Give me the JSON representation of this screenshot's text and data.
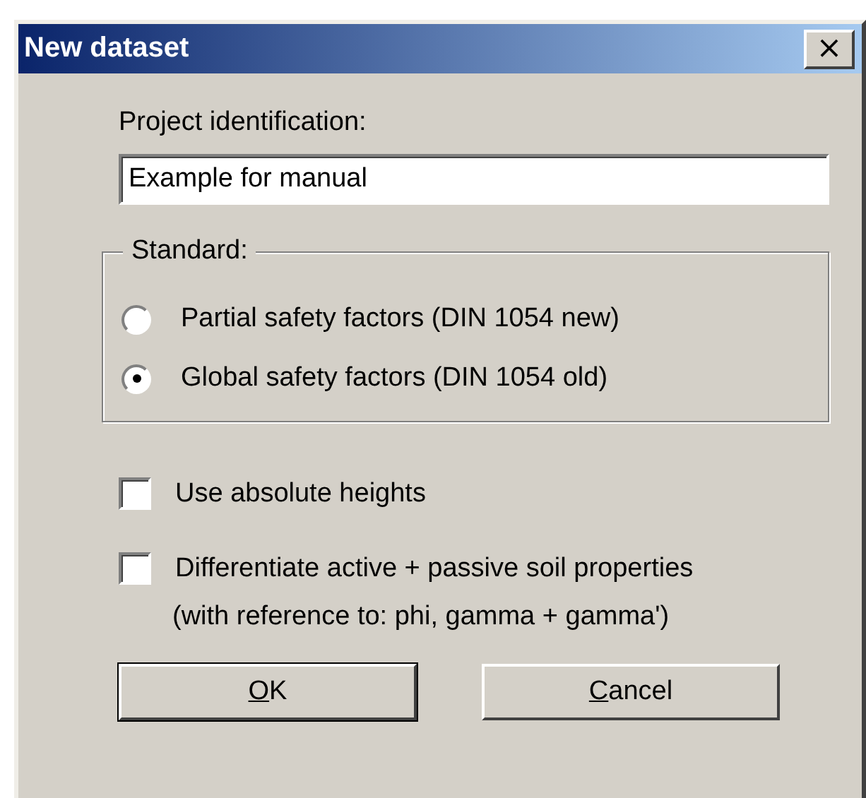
{
  "window": {
    "title": "New dataset",
    "close": "×"
  },
  "project": {
    "label": "Project identification:",
    "value": "Example for manual"
  },
  "standard": {
    "label": "Standard:",
    "options": [
      {
        "label": "Partial safety factors (DIN 1054 new)",
        "selected": false
      },
      {
        "label": "Global safety factors (DIN 1054 old)",
        "selected": true
      }
    ]
  },
  "options": [
    {
      "label": "Use absolute heights",
      "checked": false
    },
    {
      "label": "Differentiate active + passive soil properties",
      "checked": false
    }
  ],
  "note": "(with reference to: phi, gamma + gamma')",
  "buttons": [
    {
      "label": "OK",
      "default": true
    },
    {
      "label": "Cancel",
      "default": false
    }
  ]
}
